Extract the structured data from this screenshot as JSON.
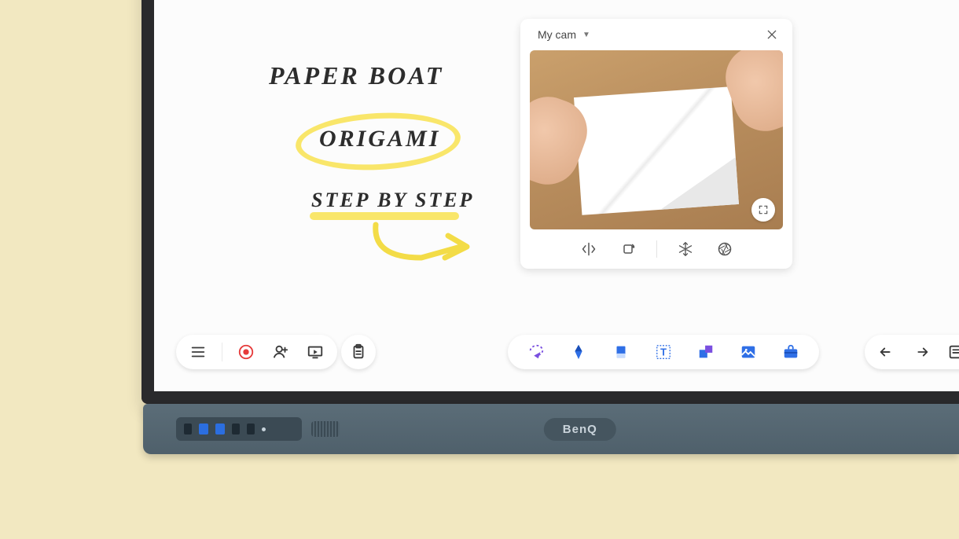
{
  "board": {
    "line1": "PAPER BOAT",
    "line2": "ORIGAMI",
    "line3": "STEP BY STEP"
  },
  "camera_panel": {
    "source_label": "My cam",
    "tools": {
      "mirror": "mirror-icon",
      "rotate": "rotate-icon",
      "freeze": "freeze-icon",
      "aperture": "aperture-icon"
    },
    "fullscreen": "fullscreen-icon",
    "close": "close-icon"
  },
  "toolbar_left": {
    "menu": "menu-icon",
    "record": "record-icon",
    "add_user": "add-user-icon",
    "present": "present-icon"
  },
  "toolbar_clip": {
    "clipboard": "clipboard-icon"
  },
  "toolbar_tools": {
    "lasso": "lasso-icon",
    "pen": "pen-icon",
    "eraser": "eraser-icon",
    "text": "text-icon",
    "shapes": "shapes-icon",
    "image": "image-icon",
    "toolbox": "toolbox-icon"
  },
  "toolbar_right": {
    "undo": "undo-icon",
    "redo": "redo-icon",
    "more": "more-panel-icon"
  },
  "device_brand": "BenQ"
}
